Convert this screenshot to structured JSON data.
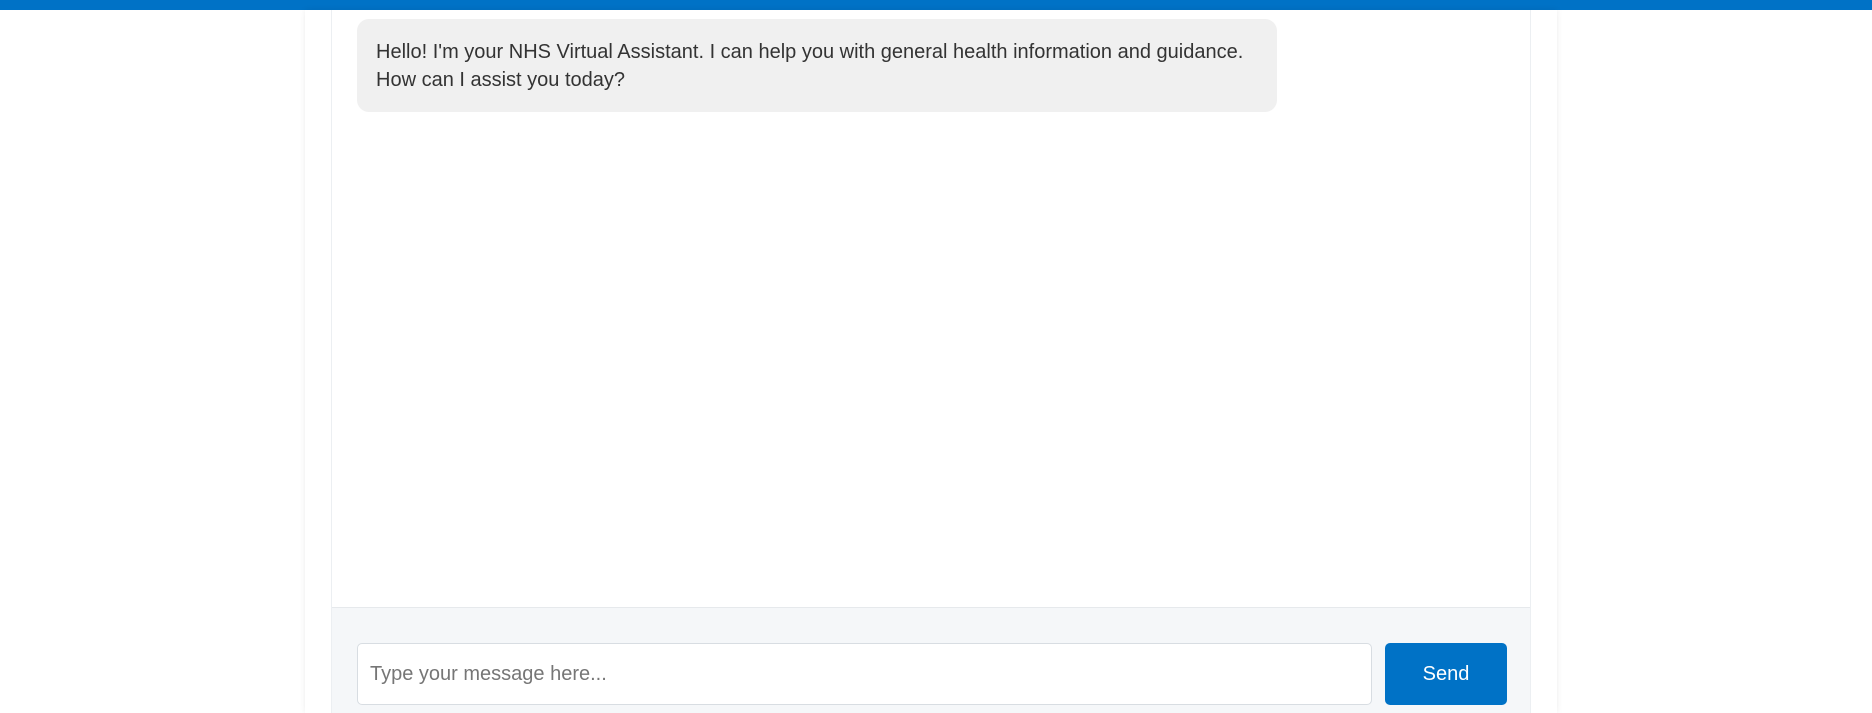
{
  "theme": {
    "accent": "#0072c6",
    "bubble_bg": "#f0f0f0",
    "input_area_bg": "#f5f7f9"
  },
  "chat": {
    "messages": [
      {
        "sender": "assistant",
        "text_line_1": "Hello! I'm your NHS Virtual Assistant. I can help you with general health information and guidance.",
        "text_line_2": "How can I assist you today?"
      }
    ]
  },
  "composer": {
    "placeholder": "Type your message here...",
    "value": "",
    "send_label": "Send"
  }
}
